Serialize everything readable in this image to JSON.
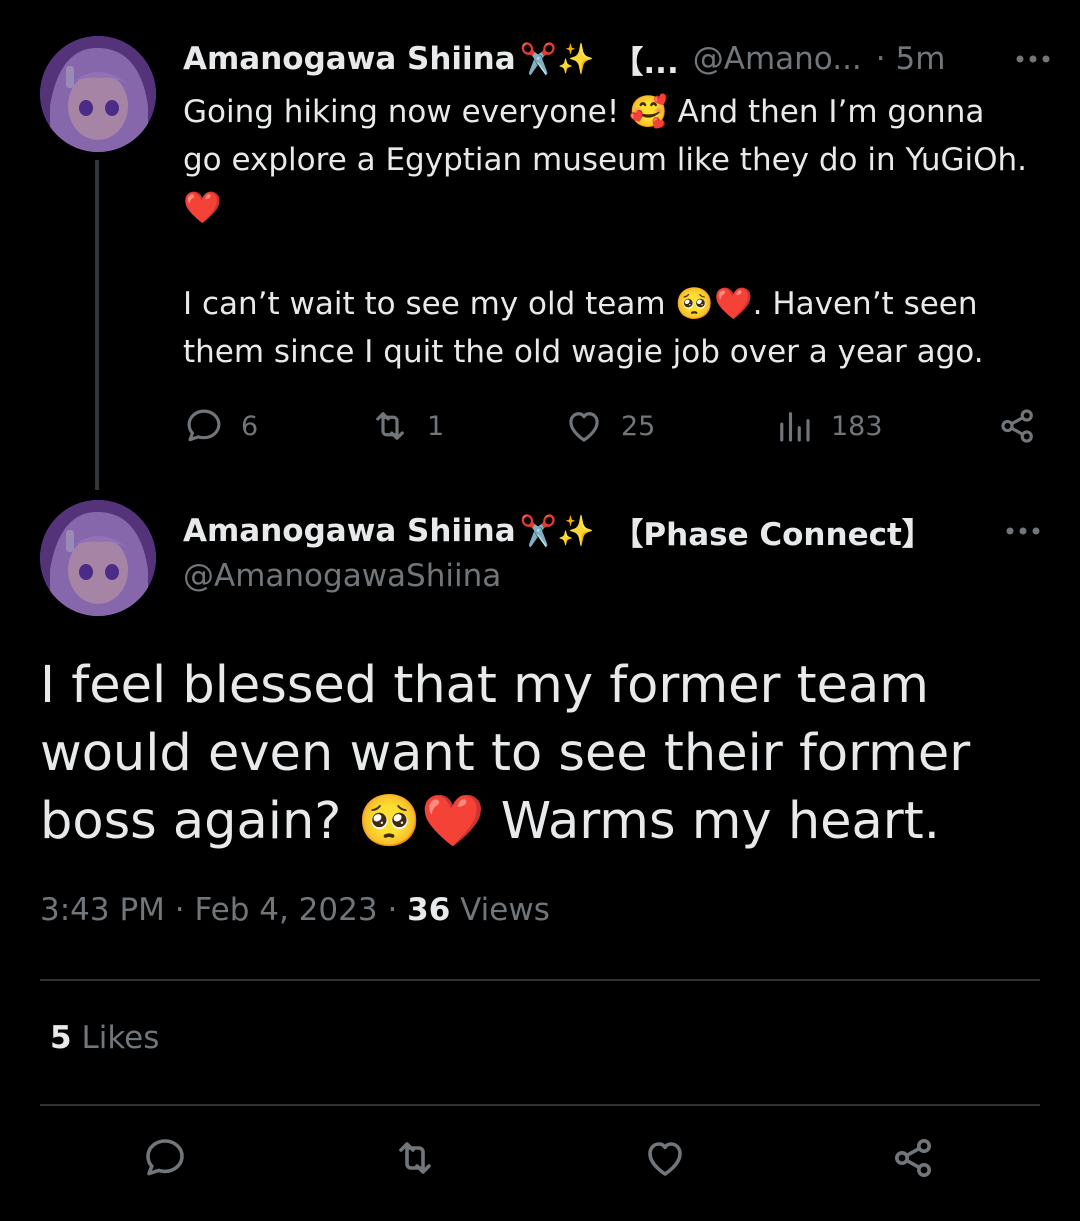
{
  "parent_tweet": {
    "author_name": "Amanogawa Shiina",
    "name_emojis": "✂️✨",
    "name_suffix": "【...",
    "handle": "@Amano...",
    "time": "· 5m",
    "more_label": "•••",
    "text_line1": "Going hiking now everyone! 🥰 And then I’m gonna",
    "text_line2": "go explore a Egyptian museum like they do in YuGiOh.",
    "text_line3": "❤️",
    "text_line4": "I can’t wait to see my old team 🥺❤️. Haven’t seen",
    "text_line5": "them since I quit the old wagie job over a year ago.",
    "replies": "6",
    "retweets": "1",
    "likes": "25",
    "views": "183"
  },
  "main_tweet": {
    "author_name": "Amanogawa Shiina",
    "name_emojis": "✂️✨",
    "name_suffix": "【Phase Connect】",
    "handle": "@AmanogawaShiina",
    "more_label": "•••",
    "text_line1": "I feel blessed that my former team",
    "text_line2": "would even want to see their former",
    "text_line3": "boss again? 🥺❤️ Warms my heart.",
    "time": "3:43 PM",
    "date": "Feb 4, 2023",
    "separator": "·",
    "views_count": "36",
    "views_label": "Views",
    "likes_count": "5",
    "likes_label": "Likes"
  },
  "colors": {
    "background": "#000000",
    "text": "#e7e9ea",
    "secondary": "#71767b",
    "divider": "#2f3336",
    "avatar": "#8a63b8"
  },
  "icons": [
    "reply-icon",
    "retweet-icon",
    "like-icon",
    "views-icon",
    "share-icon",
    "more-icon"
  ]
}
